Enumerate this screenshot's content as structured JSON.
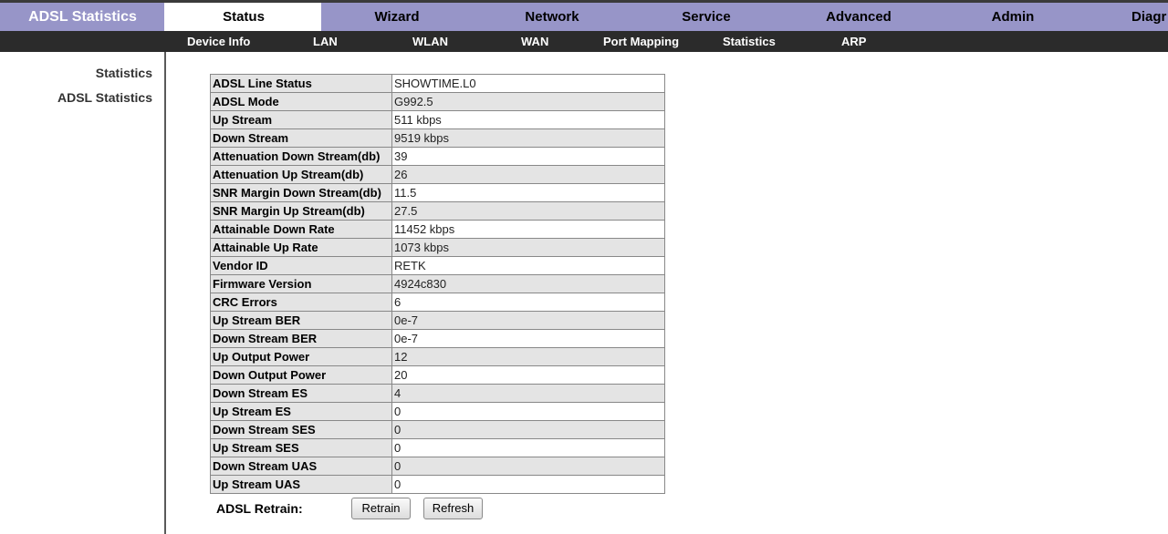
{
  "page_title": "ADSL Statistics",
  "main_tabs": [
    {
      "label": "Status",
      "active": true
    },
    {
      "label": "Wizard"
    },
    {
      "label": "Network"
    },
    {
      "label": "Service"
    },
    {
      "label": "Advanced"
    },
    {
      "label": "Admin"
    },
    {
      "label": "Diagr"
    }
  ],
  "sub_nav": [
    "Device Info",
    "LAN",
    "WLAN",
    "WAN",
    "Port Mapping",
    "Statistics",
    "ARP"
  ],
  "sidebar": {
    "items": [
      "Statistics",
      "ADSL Statistics"
    ]
  },
  "stats": [
    {
      "label": "ADSL Line Status",
      "value": "SHOWTIME.L0"
    },
    {
      "label": "ADSL Mode",
      "value": "G992.5"
    },
    {
      "label": "Up Stream",
      "value": "511 kbps"
    },
    {
      "label": "Down Stream",
      "value": "9519 kbps"
    },
    {
      "label": "Attenuation Down Stream(db)",
      "value": "39"
    },
    {
      "label": "Attenuation Up Stream(db)",
      "value": "26"
    },
    {
      "label": "SNR Margin Down Stream(db)",
      "value": "11.5"
    },
    {
      "label": "SNR Margin Up Stream(db)",
      "value": "27.5"
    },
    {
      "label": "Attainable Down Rate",
      "value": "11452 kbps"
    },
    {
      "label": "Attainable Up Rate",
      "value": "1073 kbps"
    },
    {
      "label": "Vendor ID",
      "value": "RETK"
    },
    {
      "label": "Firmware Version",
      "value": "4924c830"
    },
    {
      "label": "CRC Errors",
      "value": "6"
    },
    {
      "label": "Up Stream BER",
      "value": "0e-7"
    },
    {
      "label": "Down Stream BER",
      "value": "0e-7"
    },
    {
      "label": "Up Output Power",
      "value": "12"
    },
    {
      "label": "Down Output Power",
      "value": "20"
    },
    {
      "label": "Down Stream ES",
      "value": "4"
    },
    {
      "label": "Up Stream ES",
      "value": "0"
    },
    {
      "label": "Down Stream SES",
      "value": "0"
    },
    {
      "label": "Up Stream SES",
      "value": "0"
    },
    {
      "label": "Down Stream UAS",
      "value": "0"
    },
    {
      "label": "Up Stream UAS",
      "value": "0"
    }
  ],
  "retrain": {
    "label": "ADSL Retrain:",
    "retrain_button": "Retrain",
    "refresh_button": "Refresh"
  }
}
